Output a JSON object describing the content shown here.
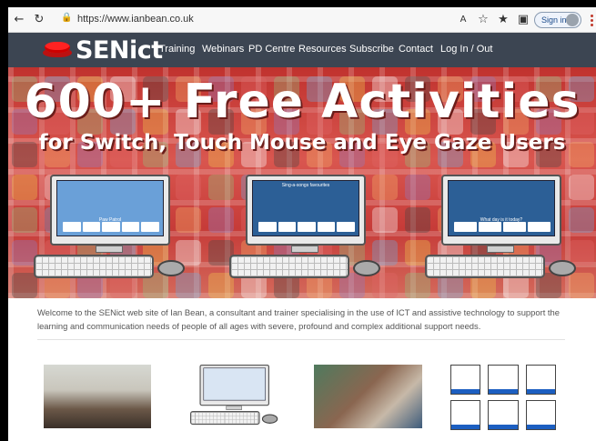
{
  "browser": {
    "url": "https://www.ianbean.co.uk",
    "signin_label": "Sign in",
    "icons": [
      "back-icon",
      "refresh-icon",
      "lock-icon",
      "read-aloud-icon",
      "add-favorite-icon",
      "favorites-icon",
      "collections-icon",
      "menu-dots-icon"
    ]
  },
  "site": {
    "logo": "SENict",
    "nav": [
      "Training",
      "Webinars",
      "PD Centre",
      "Resources",
      "Subscribe",
      "Contact",
      "Log In / Out"
    ]
  },
  "hero": {
    "title": "600+ Free Activities",
    "subtitle": "for Switch, Touch Mouse and Eye Gaze Users",
    "computers": [
      {
        "caption": "Paw Patrol"
      },
      {
        "caption": "Sing-a-songs favourites"
      },
      {
        "caption": "What day is it today?"
      }
    ]
  },
  "intro": {
    "text": "Welcome to the SENict web site of Ian Bean, a consultant and trainer specialising in the use of ICT and assistive technology to support the learning and communication needs of people of all ages with severe, profound and complex additional support needs."
  },
  "colors": {
    "nav_bg": "#3c4552",
    "hero_red": "#c0322e",
    "logo_button": "#ff2222"
  }
}
